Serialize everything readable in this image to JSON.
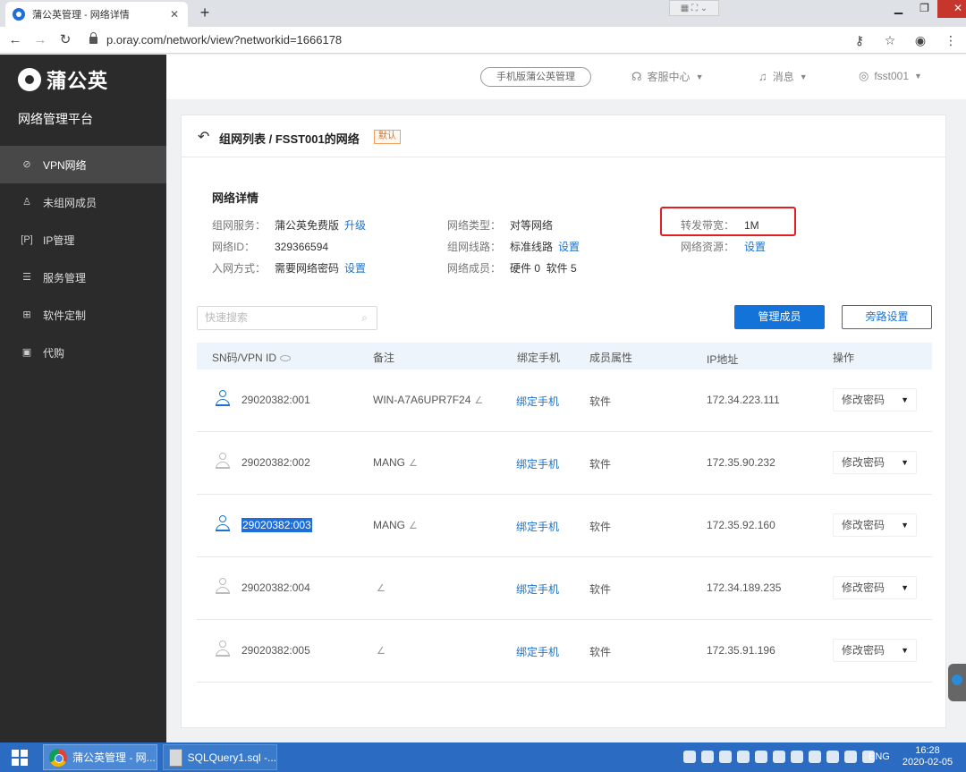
{
  "browser": {
    "tab_title": "蒲公英管理 - 网络详情",
    "url": "p.oray.com/network/view?networkid=1666178"
  },
  "sidebar": {
    "brand": "蒲公英",
    "platform": "网络管理平台",
    "items": [
      {
        "label": "VPN网络",
        "icon": "vpn-icon",
        "active": true
      },
      {
        "label": "未组网成员",
        "icon": "user-icon",
        "active": false
      },
      {
        "label": "IP管理",
        "icon": "ip-icon",
        "active": false
      },
      {
        "label": "服务管理",
        "icon": "list-icon",
        "active": false
      },
      {
        "label": "软件定制",
        "icon": "grid-icon",
        "active": false
      },
      {
        "label": "代购",
        "icon": "cart-icon",
        "active": false
      }
    ]
  },
  "header": {
    "mobile_btn": "手机版蒲公英管理",
    "service": "客服中心",
    "messages": "消息",
    "user": "fsst001"
  },
  "panel": {
    "breadcrumb": "组网列表 / FSST001的网络",
    "badge": "默认",
    "section_title": "网络详情",
    "details": {
      "service_label": "组网服务：",
      "service_value": "蒲公英免费版",
      "service_link": "升级",
      "id_label": "网络ID：",
      "id_value": "329366594",
      "join_label": "入网方式：",
      "join_value": "需要网络密码",
      "join_link": "设置",
      "type_label": "网络类型：",
      "type_value": "对等网络",
      "line_label": "组网线路：",
      "line_value": "标准线路",
      "line_link": "设置",
      "members_label": "网络成员：",
      "members_value": "硬件 0  软件 5",
      "bandwidth_label": "转发带宽：",
      "bandwidth_value": "1M",
      "resource_label": "网络资源：",
      "resource_link": "设置"
    },
    "search_placeholder": "快速搜索",
    "manage_btn": "管理成员",
    "bypass_btn": "旁路设置"
  },
  "table": {
    "headers": [
      "SN码/VPN ID",
      "备注",
      "绑定手机",
      "成员属性",
      "IP地址",
      "操作"
    ],
    "rows": [
      {
        "sn": "29020382:001",
        "note": "WIN-A7A6UPR7F24",
        "bind": "绑定手机",
        "attr": "软件",
        "ip": "172.34.223.111",
        "action": "修改密码",
        "online": true,
        "selected": false
      },
      {
        "sn": "29020382:002",
        "note": "MANG",
        "bind": "绑定手机",
        "attr": "软件",
        "ip": "172.35.90.232",
        "action": "修改密码",
        "online": false,
        "selected": false
      },
      {
        "sn": "29020382:003",
        "note": "MANG",
        "bind": "绑定手机",
        "attr": "软件",
        "ip": "172.35.92.160",
        "action": "修改密码",
        "online": true,
        "selected": true
      },
      {
        "sn": "29020382:004",
        "note": "",
        "bind": "绑定手机",
        "attr": "软件",
        "ip": "172.34.189.235",
        "action": "修改密码",
        "online": false,
        "selected": false
      },
      {
        "sn": "29020382:005",
        "note": "",
        "bind": "绑定手机",
        "attr": "软件",
        "ip": "172.35.91.196",
        "action": "修改密码",
        "online": false,
        "selected": false
      }
    ]
  },
  "taskbar": {
    "task1": "蒲公英管理 - 网...",
    "task2": "SQLQuery1.sql -...",
    "lang": "ENG",
    "time": "16:28",
    "date": "2020-02-05"
  },
  "colors": {
    "accent": "#1473d9",
    "sidebar": "#2b2b2b",
    "highlight": "#e02020"
  }
}
